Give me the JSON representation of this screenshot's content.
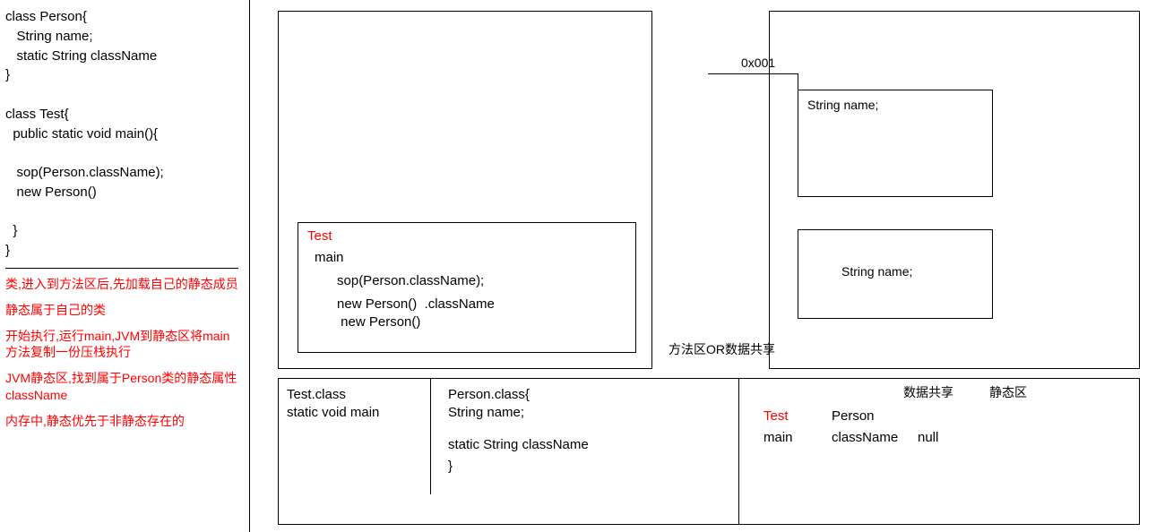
{
  "left": {
    "code": "class Person{\n   String name;\n   static String className\n}\n\nclass Test{\n  public static void main(){\n\n   sop(Person.className);\n   new Person()\n\n  }\n}",
    "notes": [
      "类,进入到方法区后,先加载自己的静态成员",
      "静态属于自己的类",
      "开始执行,运行main,JVM到静态区将main方法复制一份压栈执行",
      "JVM静态区,找到属于Person类的静态属性className",
      "内存中,静态优先于非静态存在的"
    ]
  },
  "stack": {
    "title": "Test",
    "lines": [
      "main",
      "      sop(Person.className);",
      "      new Person()  .className",
      "       new Person()"
    ]
  },
  "heap": {
    "address": "0x001",
    "obj1": "String name;",
    "obj2": "String name;"
  },
  "methodArea": {
    "label": "方法区OR数据共享",
    "test": {
      "line1": "Test.class",
      "line2": " static void main"
    },
    "person": {
      "line1": "Person.class{",
      "line2": "  String name;",
      "line3": "  static String className",
      "line4": "}"
    },
    "shared": {
      "label1": "数据共享",
      "label2": "静态区",
      "testHead": "Test",
      "testMain": " main",
      "personHead": "Person",
      "personCN": " className",
      "nullVal": "null"
    }
  }
}
